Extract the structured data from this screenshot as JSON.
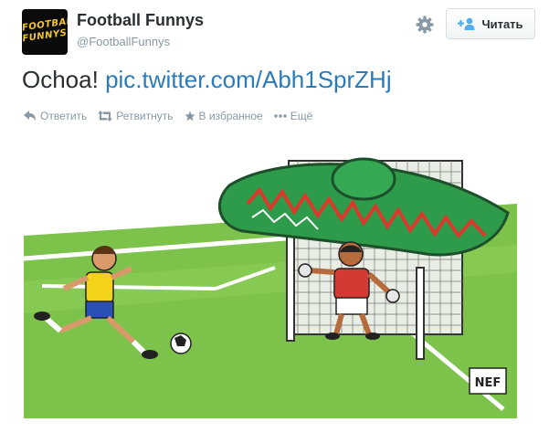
{
  "user": {
    "name": "Football Funnys",
    "handle": "@FootballFunnys",
    "avatar_text": [
      "FOOTBALL",
      "FUNNYS"
    ]
  },
  "follow_button": {
    "label": "Читать"
  },
  "tweet": {
    "text": "Ochoa!",
    "link": "pic.twitter.com/Abh1SprZHj"
  },
  "actions": [
    {
      "label": "Ответить",
      "icon": "reply-icon"
    },
    {
      "label": "Ретвитнуть",
      "icon": "retweet-icon"
    },
    {
      "label": "В избранное",
      "icon": "star-icon"
    },
    {
      "label": "Ещё",
      "icon": "more-icon"
    }
  ],
  "media": {
    "signature": "NEF"
  },
  "colors": {
    "link": "#2b7bb9",
    "text": "#292f33",
    "muted": "#8899a6",
    "grass": "#7dc24b",
    "sombrero": "#2e9b4a"
  }
}
